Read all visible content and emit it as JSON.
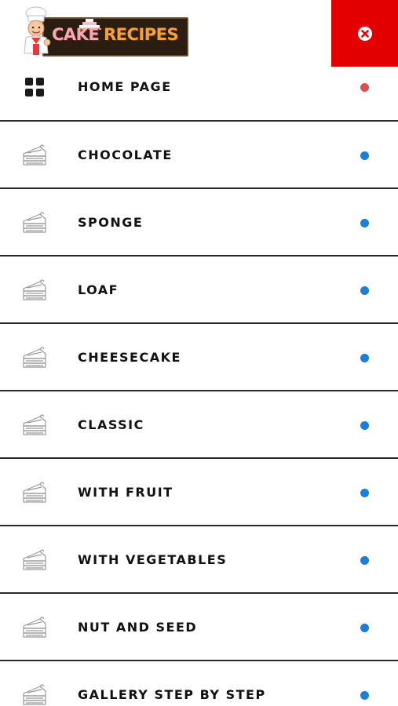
{
  "brand": {
    "word_cake": "CAKE",
    "word_recipes": "RECIPES"
  },
  "close_button": {
    "icon": "close-circle-icon",
    "color": "#e20000"
  },
  "colors": {
    "active_dot": "#e04e4e",
    "inactive_dot": "#1a7fd6",
    "separator": "#2a2a2a",
    "label": "#111111"
  },
  "menu": {
    "items": [
      {
        "label": "HOME PAGE",
        "icon": "grid-icon",
        "active": true
      },
      {
        "label": "CHOCOLATE",
        "icon": "cake-slice-icon",
        "active": false
      },
      {
        "label": "SPONGE",
        "icon": "cake-slice-icon",
        "active": false
      },
      {
        "label": "LOAF",
        "icon": "cake-slice-icon",
        "active": false
      },
      {
        "label": "CHEESECAKE",
        "icon": "cake-slice-icon",
        "active": false
      },
      {
        "label": "CLASSIC",
        "icon": "cake-slice-icon",
        "active": false
      },
      {
        "label": "WITH FRUIT",
        "icon": "cake-slice-icon",
        "active": false
      },
      {
        "label": "WITH VEGETABLES",
        "icon": "cake-slice-icon",
        "active": false
      },
      {
        "label": "NUT AND SEED",
        "icon": "cake-slice-icon",
        "active": false
      },
      {
        "label": "GALLERY STEP BY STEP",
        "icon": "cake-slice-icon",
        "active": false
      }
    ]
  }
}
